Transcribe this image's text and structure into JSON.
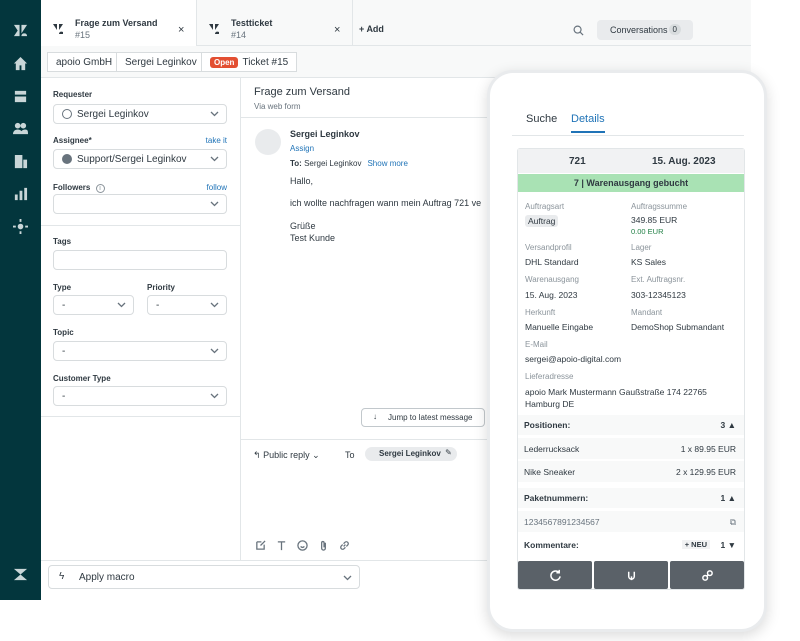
{
  "tabs": [
    {
      "title": "Frage zum Versand",
      "id": "#15"
    },
    {
      "title": "Testticket",
      "id": "#14"
    }
  ],
  "add_label": "Add",
  "conversations": {
    "label": "Conversations",
    "count": "0"
  },
  "breadcrumb": {
    "org": "apoio GmbH",
    "user": "Sergei Leginkov",
    "status": "Open",
    "ticket": "Ticket #15"
  },
  "props": {
    "requester_label": "Requester",
    "requester_value": "Sergei Leginkov",
    "assignee_label": "Assignee*",
    "assignee_link": "take it",
    "assignee_value": "Support/Sergei Leginkov",
    "followers_label": "Followers",
    "followers_link": "follow",
    "tags_label": "Tags",
    "type_label": "Type",
    "type_value": "-",
    "priority_label": "Priority",
    "priority_value": "-",
    "topic_label": "Topic",
    "topic_value": "-",
    "customer_type_label": "Customer Type",
    "customer_type_value": "-"
  },
  "conversation": {
    "subject": "Frage zum Versand",
    "via": "Via web form",
    "author": "Sergei Leginkov",
    "assign": "Assign",
    "to_label": "To:",
    "to_value": "Sergei Leginkov",
    "show_more": "Show more",
    "lines": [
      "Hallo,",
      "ich wollte nachfragen wann mein Auftrag 721 ve",
      "Grüße",
      "Test Kunde"
    ],
    "jump": "Jump to latest message",
    "reply_mode": "Public reply",
    "reply_to_label": "To",
    "reply_to_value": "Sergei Leginkov"
  },
  "macro": {
    "label": "Apply macro"
  },
  "app": {
    "tabs": [
      "Suche",
      "Details"
    ],
    "order_no": "721",
    "order_date": "15. Aug. 2023",
    "status": "7 | Warenausgang gebucht",
    "fields": {
      "auftragsart_label": "Auftragsart",
      "auftragsart": "Auftrag",
      "summe_label": "Auftragssumme",
      "summe": "349.85 EUR",
      "summe_sub": "0.00 EUR",
      "versand_label": "Versandprofil",
      "versand": "DHL Standard",
      "lager_label": "Lager",
      "lager": "KS Sales",
      "warenausgang_label": "Warenausgang",
      "warenausgang": "15. Aug. 2023",
      "extnr_label": "Ext. Auftragsnr.",
      "extnr": "303-12345123",
      "herkunft_label": "Herkunft",
      "herkunft": "Manuelle Eingabe",
      "mandant_label": "Mandant",
      "mandant": "DemoShop Submandant",
      "email_label": "E-Mail",
      "email": "sergei@apoio-digital.com",
      "adresse_label": "Lieferadresse",
      "adresse1": "apoio Mark Mustermann Gaußstraße 174 22765",
      "adresse2": "Hamburg DE"
    },
    "positionen": {
      "label": "Positionen:",
      "count": "3 ▲",
      "items": [
        {
          "name": "Lederrucksack",
          "qty": "1 x 89.95 EUR"
        },
        {
          "name": "Nike Sneaker",
          "qty": "2 x 129.95 EUR"
        }
      ]
    },
    "paket": {
      "label": "Paketnummern:",
      "count": "1 ▲",
      "number": "1234567891234567"
    },
    "kommentare": {
      "label": "Kommentare:",
      "neu": "+ NEU",
      "count": "1 ▼"
    }
  }
}
